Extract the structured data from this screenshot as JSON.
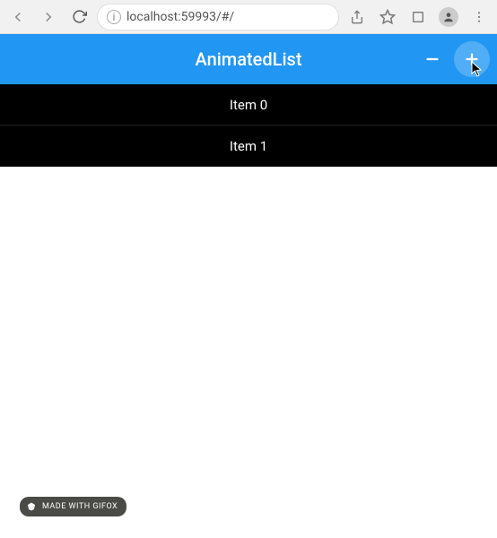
{
  "browser": {
    "url": "localhost:59993/#/"
  },
  "appbar": {
    "title": "AnimatedList"
  },
  "list": {
    "items": [
      "Item 0",
      "Item 1"
    ]
  },
  "watermark": {
    "text": "MADE WITH GIFOX"
  }
}
